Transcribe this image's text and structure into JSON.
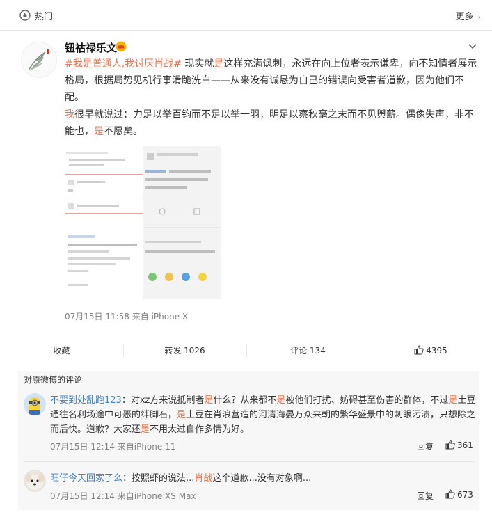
{
  "topbar": {
    "hot_label": "热门",
    "more_label": "更多",
    "more_chevron": "›"
  },
  "post": {
    "username": "钮祜禄乐文",
    "paragraph1": {
      "hashtag": "#我是普通人,我讨厌肖战#",
      "text_a": " 现实就",
      "hl1": "是",
      "text_b": "这样充满讽刺，永远在向上位者表示谦卑，向不知情者展示格局，根据局势见机行事滑跪洗白——从来没有诚恳为自己的错误向受害者道歉，因为他们不配。"
    },
    "paragraph2": {
      "hl_wo": "我",
      "text_a": "很早就说过：力足以举百钧而不足以举一羽，明足以察秋毫之末而不见舆薪。偶像失声，非不能也，",
      "hl_shi": "是",
      "text_b": "不愿矣。"
    },
    "meta": "07月15日 11:58  来自 iPhone X"
  },
  "actions": {
    "favorite": "收藏",
    "repost": "转发 1026",
    "comment": "评论 134",
    "like_count": "4395"
  },
  "comments": {
    "title": "对原微博的评论",
    "items": [
      {
        "name": "不要到处乱跑123",
        "p1": "：对xz方来说抵制者",
        "h1": "是",
        "p2": "什么？从来都不",
        "h2": "是",
        "p3": "被他们打扰、妨碍甚至伤害的群体，不过",
        "h3": "是",
        "p4": "土豆通往名利场途中可恶的绊脚石，",
        "h4": "是",
        "p5": "土豆在肖浪营造的河清海晏万众来朝的繁华盛景中的刺眼污渍，只想除之而后快。道歉？大家还",
        "h5": "是",
        "p6": "不用太过自作多情为好。",
        "meta": "07月15日 12:14 来自iPhone 11",
        "reply": "回复",
        "likes": "361"
      },
      {
        "name": "旺仔今天回家了么",
        "p1": "：按照虾的说法...",
        "h1": "肖战",
        "p2": "这个道歉...没有对象啊...",
        "meta": "07月15日 12:14 来自iPhone XS Max",
        "reply": "回复",
        "likes": "673"
      }
    ]
  },
  "colors": {
    "accent": "#eb7350",
    "link": "#4080c0",
    "muted": "#808080"
  }
}
